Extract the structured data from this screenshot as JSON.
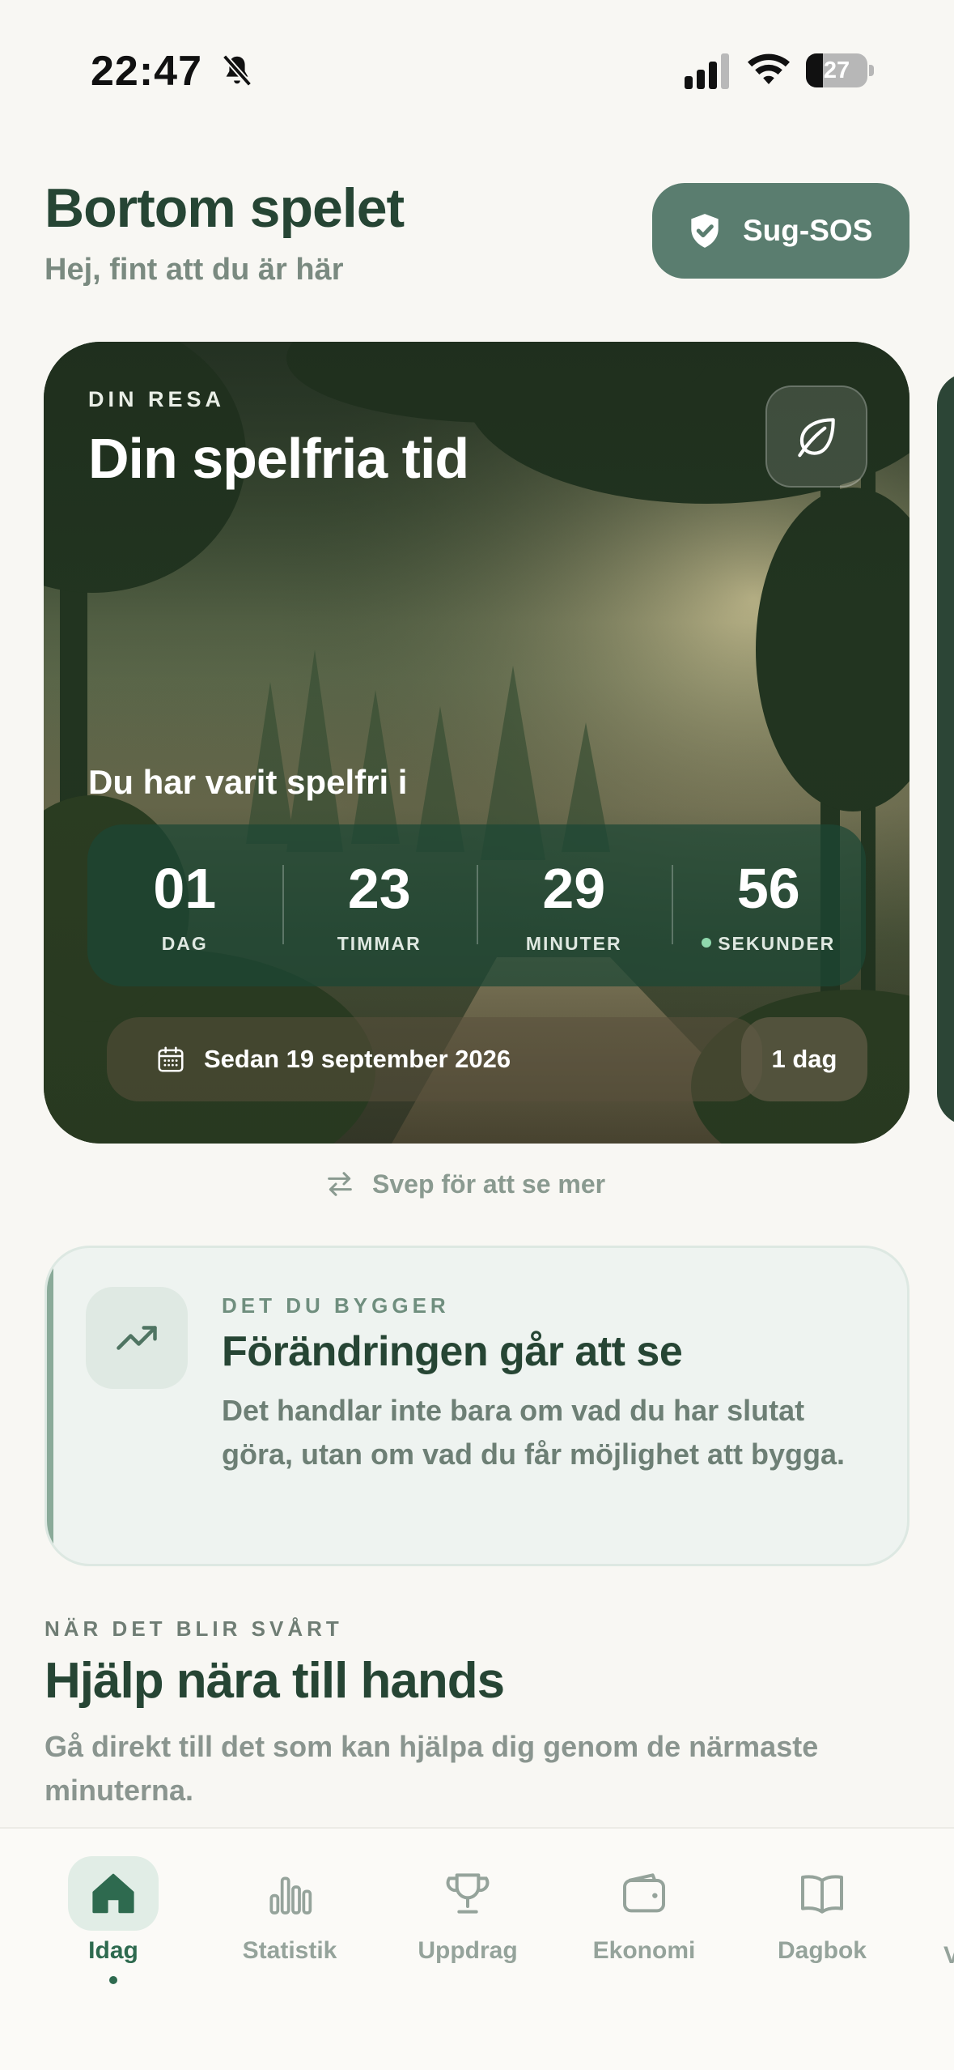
{
  "status_bar": {
    "time": "22:47",
    "battery_level": "27",
    "battery_fraction": 0.27,
    "icons": [
      "bell-slash-icon",
      "cellular-signal-icon",
      "wifi-icon",
      "battery-icon"
    ]
  },
  "header": {
    "title": "Bortom spelet",
    "subtitle": "Hej, fint att du är här",
    "sos_label": "Sug-SOS",
    "sos_icon": "shield-check-icon"
  },
  "hero": {
    "overline": "DIN RESA",
    "title": "Din spelfria tid",
    "lead": "Du har varit spelfri i",
    "leaf_icon": "leaf-icon",
    "counters": [
      {
        "value": "01",
        "unit": "DAG"
      },
      {
        "value": "23",
        "unit": "TIMMAR"
      },
      {
        "value": "29",
        "unit": "MINUTER"
      },
      {
        "value": "56",
        "unit": "SEKUNDER"
      }
    ],
    "since_text": "Sedan 19 september 2026",
    "days_badge": "1 dag"
  },
  "swipe_hint": "Svep för att se mer",
  "build_card": {
    "overline": "DET DU BYGGER",
    "title": "Förändringen går att se",
    "body": "Det handlar inte bara om vad du har slutat göra, utan om vad du får möjlighet att bygga.",
    "icon": "trend-up-icon"
  },
  "help_section": {
    "overline": "NÄR DET BLIR SVÅRT",
    "title": "Hjälp nära till hands",
    "body": "Gå direkt till det som kan hjälpa dig genom de närmaste minuterna."
  },
  "tab_bar": {
    "tabs": [
      {
        "label": "Idag",
        "icon": "home-icon",
        "active": true
      },
      {
        "label": "Statistik",
        "icon": "bar-chart-icon",
        "active": false
      },
      {
        "label": "Uppdrag",
        "icon": "trophy-icon",
        "active": false
      },
      {
        "label": "Ekonomi",
        "icon": "wallet-icon",
        "active": false
      },
      {
        "label": "Dagbok",
        "icon": "book-icon",
        "active": false
      }
    ],
    "cutoff_label": "V"
  },
  "colors": {
    "background": "#f8f7f3",
    "primary_green": "#264534",
    "accent_green": "#5a7d6f",
    "active_tab": "#2e6a4f",
    "muted_text": "#7a8a80"
  }
}
